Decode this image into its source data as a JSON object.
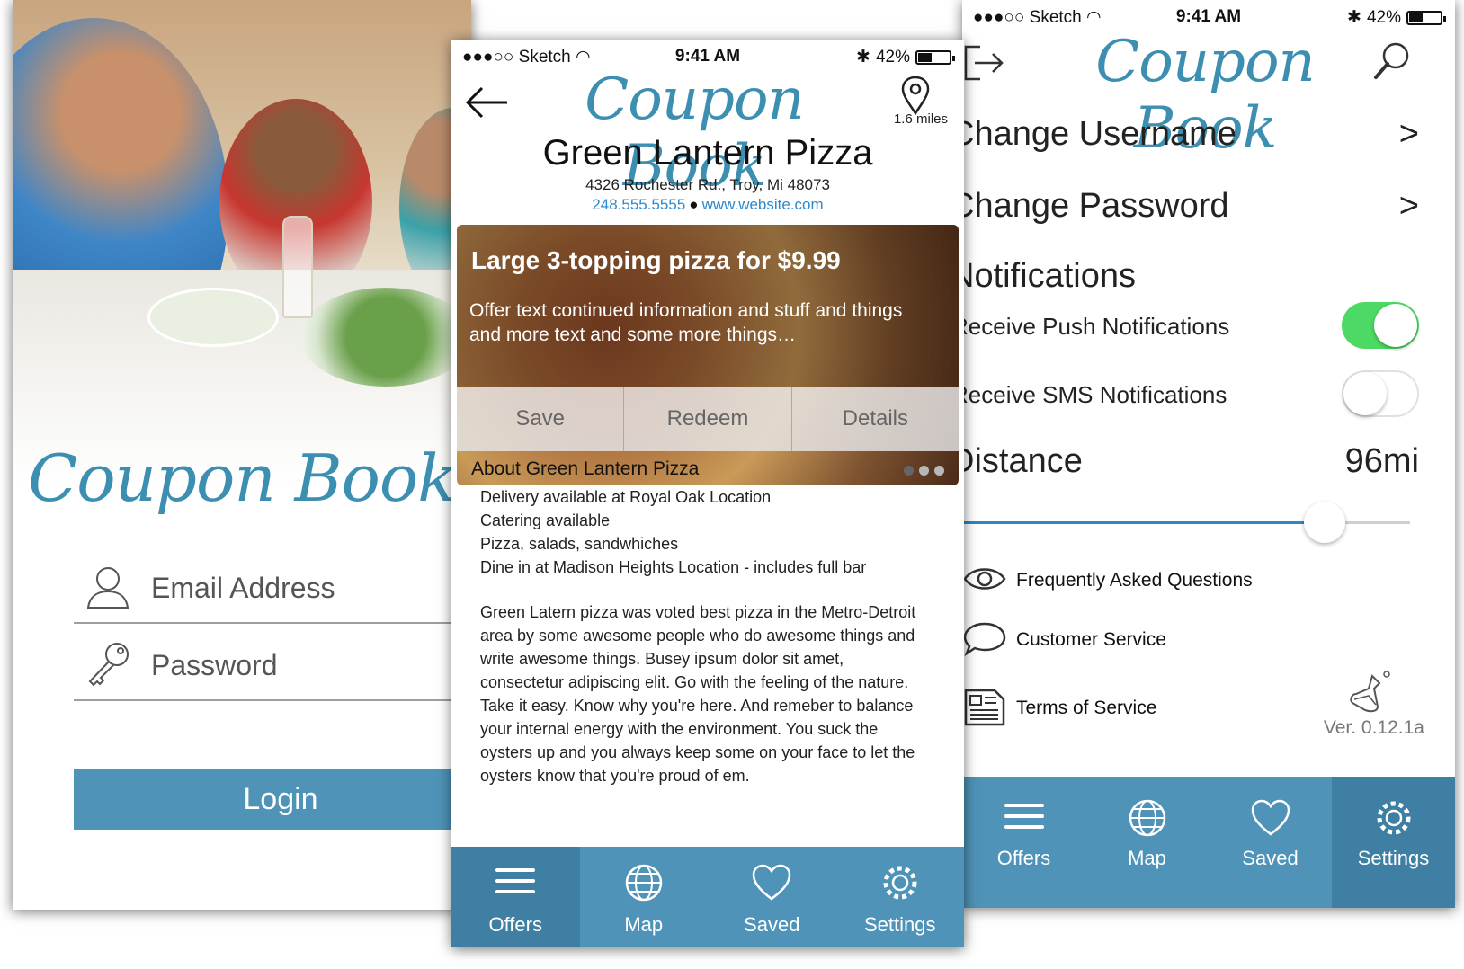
{
  "status_bar": {
    "carrier": "●●●○○ Sketch",
    "time": "9:41 AM",
    "battery": "42%"
  },
  "brand": {
    "logo": "Coupon Book",
    "accent": "#4f93b8",
    "logo_color": "#3c8fb1"
  },
  "login": {
    "email_placeholder": "Email Address",
    "password_placeholder": "Password",
    "login_label": "Login"
  },
  "detail": {
    "distance": "1.6 miles",
    "business_name": "Green Lantern Pizza",
    "address": "4326 Rochester Rd., Troy, Mi 48073",
    "phone": "248.555.5555",
    "separator": "●",
    "website": "www.website.com",
    "offer": {
      "title": "Large 3-topping pizza for $9.99",
      "text": "Offer text continued information and stuff and things and more text and some more things…",
      "actions": [
        "Save",
        "Redeem",
        "Details"
      ]
    },
    "about_title": "About Green Lantern Pizza",
    "about_items": [
      "Delivery available at Royal Oak Location",
      "Catering available",
      "Pizza, salads, sandwhiches",
      "Dine in at Madison Heights Location - includes full bar"
    ],
    "about_body": "Green Latern pizza was voted best pizza in the Metro-Detroit area by some awesome people who do awesome things and write awesome things. Busey ipsum dolor sit amet, consectetur adipiscing elit. Go with the feeling of the nature. Take it easy. Know why you're here. And remeber to balance your internal energy with the environment. You suck the oysters up and you always keep some on your face to let the oysters know that you're proud of em."
  },
  "tabs": {
    "offers": "Offers",
    "map": "Map",
    "saved": "Saved",
    "settings": "Settings"
  },
  "settings": {
    "change_username": "Change Username",
    "change_password": "Change Password",
    "chevron": ">",
    "notifications_header": "Notifications",
    "push_label": "Receive Push Notifications",
    "push_enabled": true,
    "sms_label": "Receive SMS Notifications",
    "sms_enabled": false,
    "distance_label": "Distance",
    "distance_value": "96mi",
    "distance_slider_fraction": 0.88,
    "faq": "Frequently Asked Questions",
    "customer_service": "Customer Service",
    "terms": "Terms of Service",
    "version": "Ver. 0.12.1a"
  }
}
